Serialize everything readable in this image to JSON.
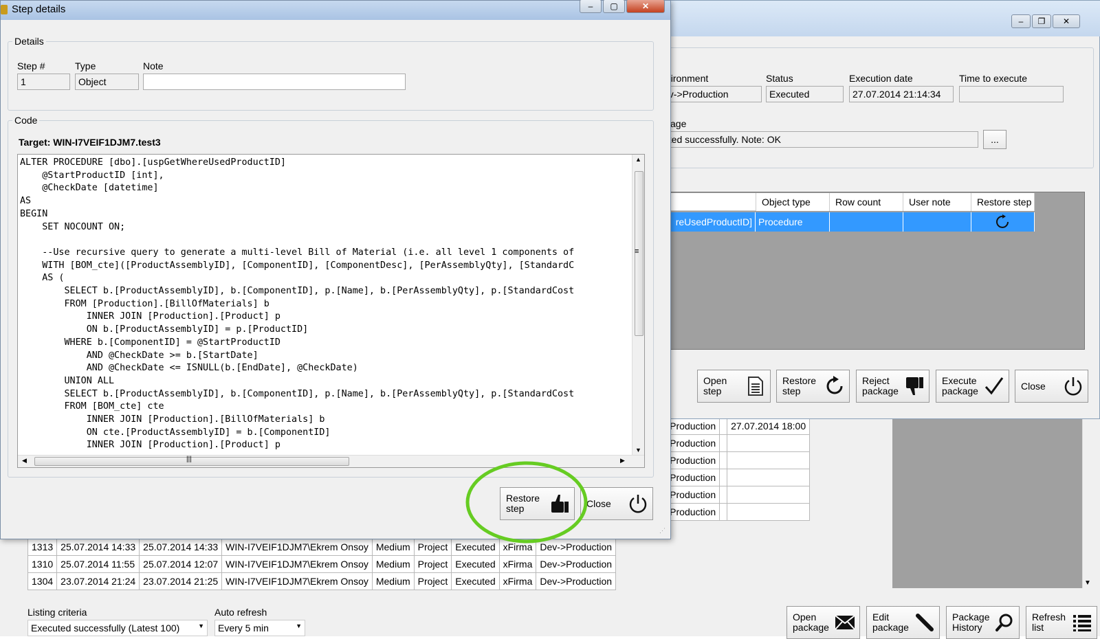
{
  "step_window": {
    "title": "Step details",
    "details_group": "Details",
    "step_label": "Step #",
    "step_value": "1",
    "type_label": "Type",
    "type_value": "Object",
    "note_label": "Note",
    "note_value": "",
    "code_group": "Code",
    "target": "Target: WIN-I7VEIF1DJM7.test3",
    "code_lines": [
      "ALTER PROCEDURE [dbo].[uspGetWhereUsedProductID]",
      "    @StartProductID [int],",
      "    @CheckDate [datetime]",
      "AS",
      "BEGIN",
      "    SET NOCOUNT ON;",
      "",
      "    --Use recursive query to generate a multi-level Bill of Material (i.e. all level 1 components of",
      "    WITH [BOM_cte]([ProductAssemblyID], [ComponentID], [ComponentDesc], [PerAssemblyQty], [StandardC",
      "    AS (",
      "        SELECT b.[ProductAssemblyID], b.[ComponentID], p.[Name], b.[PerAssemblyQty], p.[StandardCost",
      "        FROM [Production].[BillOfMaterials] b",
      "            INNER JOIN [Production].[Product] p",
      "            ON b.[ProductAssemblyID] = p.[ProductID]",
      "        WHERE b.[ComponentID] = @StartProductID",
      "            AND @CheckDate >= b.[StartDate]",
      "            AND @CheckDate <= ISNULL(b.[EndDate], @CheckDate)",
      "        UNION ALL",
      "        SELECT b.[ProductAssemblyID], b.[ComponentID], p.[Name], b.[PerAssemblyQty], p.[StandardCost",
      "        FROM [BOM_cte] cte",
      "            INNER JOIN [Production].[BillOfMaterials] b",
      "            ON cte.[ProductAssemblyID] = b.[ComponentID]",
      "            INNER JOIN [Production].[Product] p"
    ],
    "restore_btn": "Restore\nstep",
    "close_btn": "Close"
  },
  "package_window": {
    "env_label": "nvironment",
    "env_value": "ev->Production",
    "status_label": "Status",
    "status_value": "Executed",
    "exec_date_label": "Execution date",
    "exec_date_value": "27.07.2014 21:14:34",
    "time_label": "Time to execute",
    "time_value": "",
    "message_label": "ssage",
    "message_value": "uted successfully. Note: OK",
    "ellipsis_btn": "...",
    "grid_headers": [
      "Object type",
      "Row count",
      "User note",
      "Restore step"
    ],
    "grid_row": {
      "name": "reUsedProductID]",
      "type": "Procedure",
      "rows": "",
      "note": ""
    },
    "buttons": [
      {
        "label": "Open\nstep",
        "icon": "document-icon"
      },
      {
        "label": "Restore\nstep",
        "icon": "refresh-icon"
      },
      {
        "label": "Reject\npackage",
        "icon": "thumbs-down-icon"
      },
      {
        "label": "Execute\npackage",
        "icon": "checkmark-icon"
      },
      {
        "label": "Close",
        "icon": "power-icon"
      }
    ]
  },
  "main_window": {
    "side_rows": [
      {
        "env": ">Production",
        "date": "27.07.2014 18:00"
      },
      {
        "env": ">Production",
        "date": ""
      },
      {
        "env": ">Production",
        "date": ""
      },
      {
        "env": ">Production",
        "date": ""
      },
      {
        "env": ">Production",
        "date": ""
      },
      {
        "env": ">Production",
        "date": ""
      }
    ],
    "rows": [
      [
        "1313",
        "25.07.2014 14:33",
        "25.07.2014 14:33",
        "WIN-I7VEIF1DJM7\\Ekrem Onsoy",
        "Medium",
        "Project",
        "Executed",
        "xFirma",
        "Dev->Production"
      ],
      [
        "1310",
        "25.07.2014 11:55",
        "25.07.2014 12:07",
        "WIN-I7VEIF1DJM7\\Ekrem Onsoy",
        "Medium",
        "Project",
        "Executed",
        "xFirma",
        "Dev->Production"
      ],
      [
        "1304",
        "23.07.2014 21:24",
        "23.07.2014 21:25",
        "WIN-I7VEIF1DJM7\\Ekrem Onsoy",
        "Medium",
        "Project",
        "Executed",
        "xFirma",
        "Dev->Production"
      ]
    ],
    "listing_label": "Listing criteria",
    "listing_value": "Executed successfully (Latest 100)",
    "refresh_label": "Auto refresh",
    "refresh_value": "Every 5 min",
    "bottom_buttons": [
      {
        "label": "Open\npackage",
        "icon": "envelope-icon"
      },
      {
        "label": "Edit\npackage",
        "icon": "pencil-icon"
      },
      {
        "label": "Package\nHistory",
        "icon": "magnifier-icon"
      },
      {
        "label": "Refresh\nlist",
        "icon": "list-icon"
      }
    ]
  },
  "colors": {
    "highlight_circle": "#66cc22",
    "selection": "#3399ff",
    "grid_bg": "#a0a0a0"
  }
}
